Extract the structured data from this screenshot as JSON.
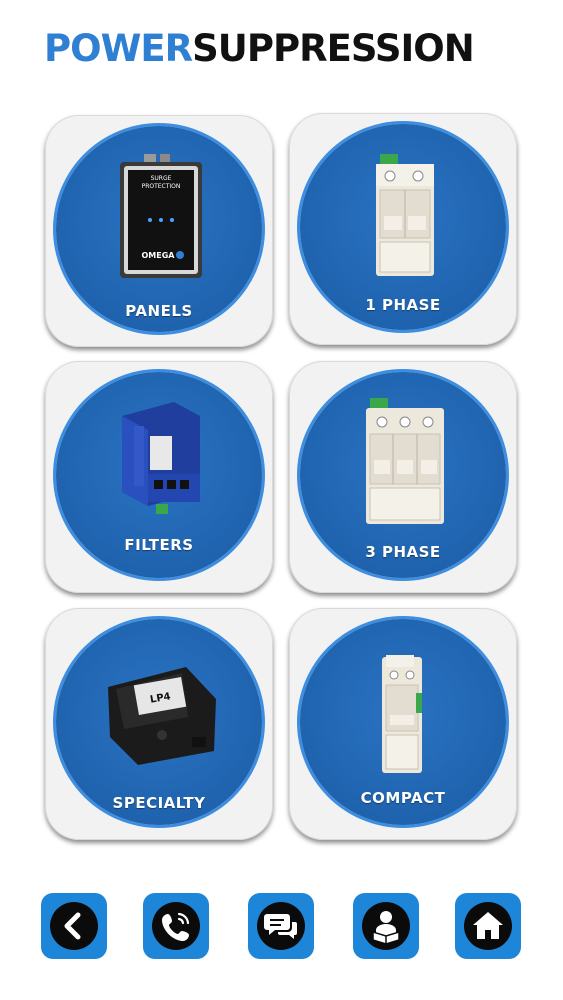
{
  "header": {
    "logo_part1": "POWER",
    "logo_part2": "SUPPRESSION"
  },
  "tiles": [
    {
      "label": "PANELS",
      "product_text": [
        "SURGE",
        "PROTECTION"
      ],
      "brand": "OMEGA"
    },
    {
      "label": "1 PHASE"
    },
    {
      "label": "FILTERS"
    },
    {
      "label": "3 PHASE"
    },
    {
      "label": "SPECIALTY",
      "product_text": "LP4"
    },
    {
      "label": "COMPACT"
    }
  ],
  "nav": [
    {
      "icon": "chevron-left-icon"
    },
    {
      "icon": "phone-call-icon"
    },
    {
      "icon": "chat-bubbles-icon"
    },
    {
      "icon": "reader-manual-icon"
    },
    {
      "icon": "home-icon"
    }
  ],
  "colors": {
    "brand_blue": "#2f7fd2",
    "circle_blue": "#1f63ae",
    "nav_blue": "#1e86d8",
    "tile_bg": "#f2f2f2"
  }
}
